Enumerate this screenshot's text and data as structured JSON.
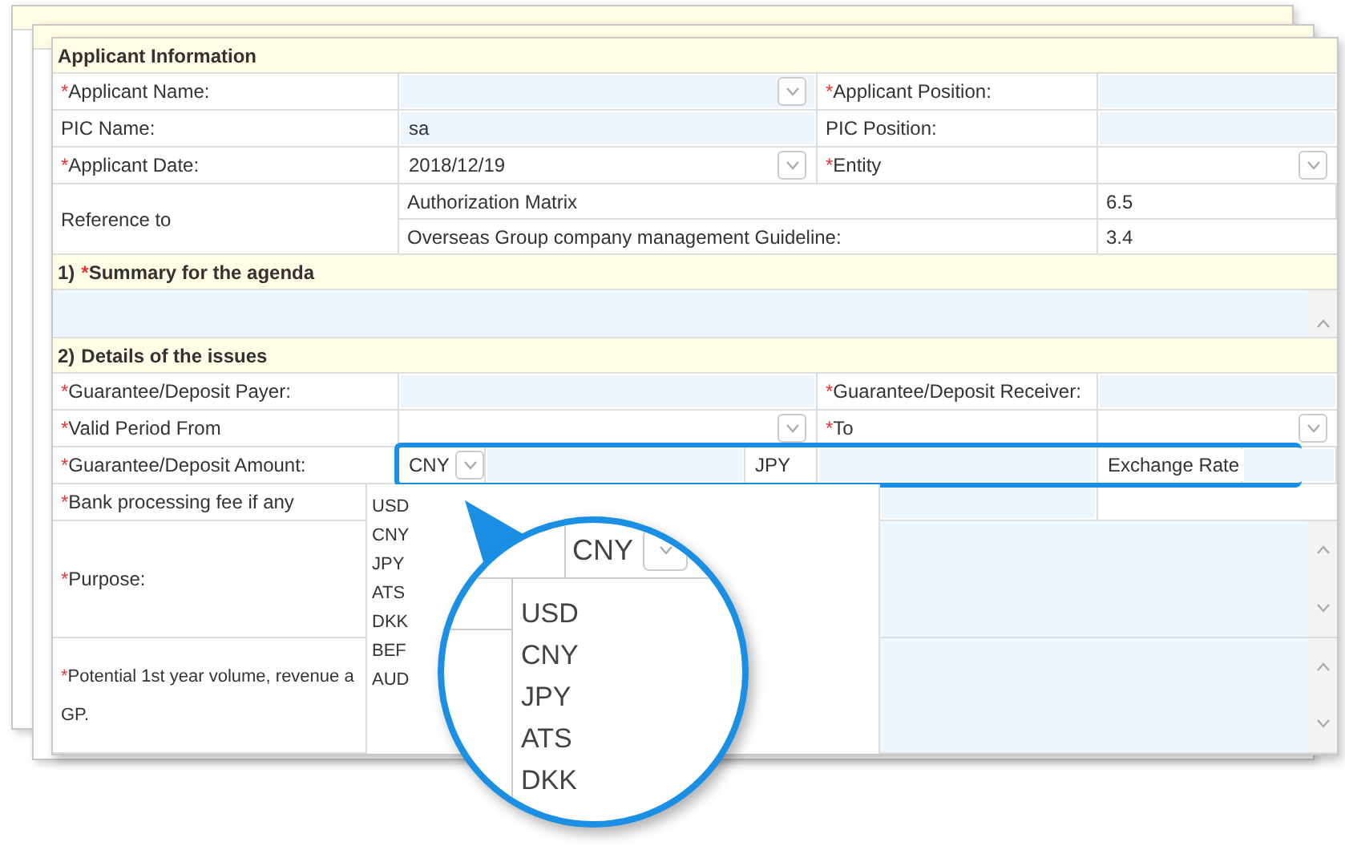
{
  "rows": [
    {
      "kind": "section",
      "title": "Applicant Information"
    },
    {
      "kind": "fields",
      "cells": [
        {
          "kind": "label",
          "mark": "*",
          "text": "Applicant Name:"
        },
        {
          "kind": "combo"
        },
        {
          "kind": "label",
          "mark": "*",
          "text": "Applicant Position:"
        },
        {
          "kind": "input"
        }
      ]
    },
    {
      "kind": "fields",
      "cells": [
        {
          "kind": "label",
          "text": "PIC Name:"
        },
        {
          "kind": "input",
          "value": "sa"
        },
        {
          "kind": "label",
          "text": "PIC Position:"
        },
        {
          "kind": "input"
        }
      ]
    },
    {
      "kind": "fields",
      "cells": [
        {
          "kind": "label",
          "mark": "*",
          "text": "Applicant Date:"
        },
        {
          "kind": "select",
          "value": "2018/12/19"
        },
        {
          "kind": "label",
          "mark": "*",
          "text": "Entity"
        },
        {
          "kind": "select"
        }
      ]
    },
    {
      "kind": "reference",
      "label": "Reference to",
      "items": [
        {
          "text": "Authorization Matrix",
          "value": "6.5"
        },
        {
          "text": "Overseas Group company management Guideline:",
          "value": "3.4"
        }
      ]
    },
    {
      "kind": "section",
      "number": "1)",
      "mark": "*",
      "title": "Summary for the agenda"
    },
    {
      "kind": "textarea"
    },
    {
      "kind": "section",
      "number": "2)",
      "title": "Details of the issues"
    },
    {
      "kind": "fields",
      "cells": [
        {
          "kind": "label",
          "mark": "*",
          "text": "Guarantee/Deposit Payer:"
        },
        {
          "kind": "input"
        },
        {
          "kind": "label",
          "mark": "*",
          "text": "Guarantee/Deposit Receiver:"
        },
        {
          "kind": "input"
        }
      ]
    },
    {
      "kind": "fields",
      "cells": [
        {
          "kind": "label",
          "mark": "*",
          "text": "Valid Period From"
        },
        {
          "kind": "select"
        },
        {
          "kind": "label",
          "mark": "*",
          "text": "To"
        },
        {
          "kind": "select"
        }
      ]
    },
    {
      "kind": "amount",
      "mark": "*",
      "label": "Guarantee/Deposit Amount:",
      "parts": [
        {
          "kind": "select",
          "value": "CNY"
        },
        {
          "kind": "input"
        },
        {
          "kind": "text",
          "text": "JPY"
        },
        {
          "kind": "input"
        },
        {
          "kind": "text",
          "text": "Exchange Rate"
        },
        {
          "kind": "input"
        }
      ]
    }
  ],
  "lower": {
    "rows": [
      {
        "kind": "input",
        "mark": "*",
        "label_lines": [
          "Bank processing fee if any"
        ]
      },
      {
        "kind": "textarea",
        "mark": "*",
        "label_lines": [
          "Purpose:"
        ]
      },
      {
        "kind": "textarea",
        "mark": "*",
        "label_lines": [
          "Potential 1st year volume, revenue a",
          "GP."
        ]
      }
    ],
    "dropdown_options": [
      "USD",
      "CNY",
      "JPY",
      "ATS",
      "DKK",
      "BEF",
      "AUD"
    ]
  },
  "magnifier": {
    "select_value": "CNY",
    "options": [
      "USD",
      "CNY",
      "JPY",
      "ATS",
      "DKK"
    ]
  }
}
